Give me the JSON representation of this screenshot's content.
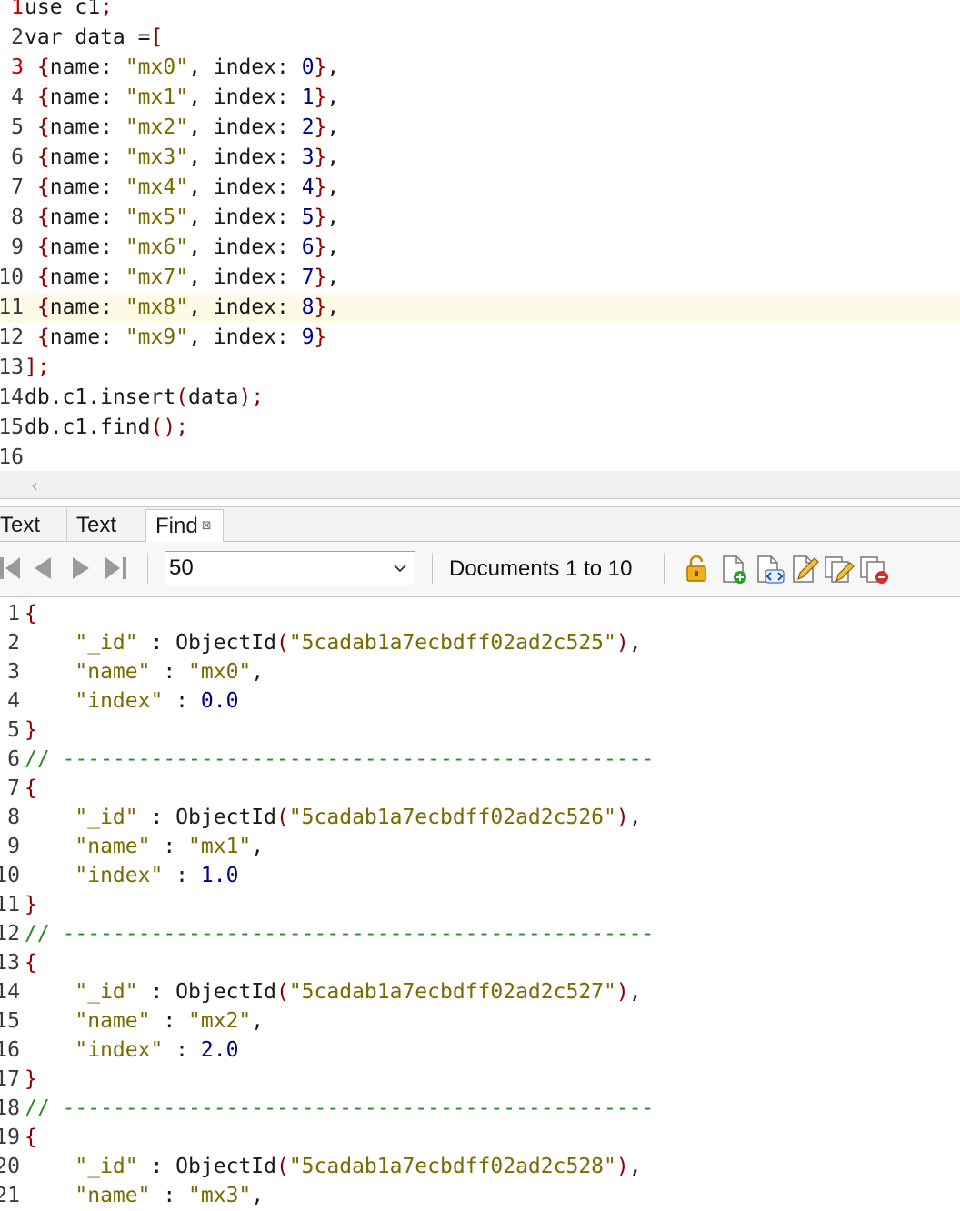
{
  "editor": {
    "lines": [
      {
        "num": "1",
        "code": "use c1;",
        "num_red": true
      },
      {
        "num": "2",
        "code": "var data =[",
        "num_red": false
      },
      {
        "num": "3",
        "code": " {name: \"mx0\", index: 0},",
        "num_red": true
      },
      {
        "num": "4",
        "code": " {name: \"mx1\", index: 1},",
        "num_red": false
      },
      {
        "num": "5",
        "code": " {name: \"mx2\", index: 2},",
        "num_red": false
      },
      {
        "num": "6",
        "code": " {name: \"mx3\", index: 3},",
        "num_red": false
      },
      {
        "num": "7",
        "code": " {name: \"mx4\", index: 4},",
        "num_red": false
      },
      {
        "num": "8",
        "code": " {name: \"mx5\", index: 5},",
        "num_red": false
      },
      {
        "num": "9",
        "code": " {name: \"mx6\", index: 6},",
        "num_red": false
      },
      {
        "num": "10",
        "code": " {name: \"mx7\", index: 7},",
        "num_red": false
      },
      {
        "num": "11",
        "code": " {name: \"mx8\", index: 8},",
        "num_red": false,
        "highlight": true
      },
      {
        "num": "12",
        "code": " {name: \"mx9\", index: 9}",
        "num_red": false
      },
      {
        "num": "13",
        "code": "];",
        "num_red": false
      },
      {
        "num": "14",
        "code": "db.c1.insert(data);",
        "num_red": false
      },
      {
        "num": "15",
        "code": "db.c1.find();",
        "num_red": false
      },
      {
        "num": "16",
        "code": "",
        "num_red": false
      }
    ]
  },
  "tabs": [
    {
      "label": "Text"
    },
    {
      "label": "Text"
    },
    {
      "label": "Find",
      "active": true,
      "close": "⊠"
    }
  ],
  "toolbar": {
    "page_size": "50",
    "documents_label": "Documents 1 to 10"
  },
  "results": {
    "lines": [
      "{",
      "    \"_id\" : ObjectId(\"5cadab1a7ecbdff02ad2c525\"),",
      "    \"name\" : \"mx0\",",
      "    \"index\" : 0.0",
      "}",
      "// -----------------------------------------------",
      "{",
      "    \"_id\" : ObjectId(\"5cadab1a7ecbdff02ad2c526\"),",
      "    \"name\" : \"mx1\",",
      "    \"index\" : 1.0",
      "}",
      "// -----------------------------------------------",
      "{",
      "    \"_id\" : ObjectId(\"5cadab1a7ecbdff02ad2c527\"),",
      "    \"name\" : \"mx2\",",
      "    \"index\" : 2.0",
      "}",
      "// -----------------------------------------------",
      "{",
      "    \"_id\" : ObjectId(\"5cadab1a7ecbdff02ad2c528\"),",
      "    \"name\" : \"mx3\","
    ]
  }
}
